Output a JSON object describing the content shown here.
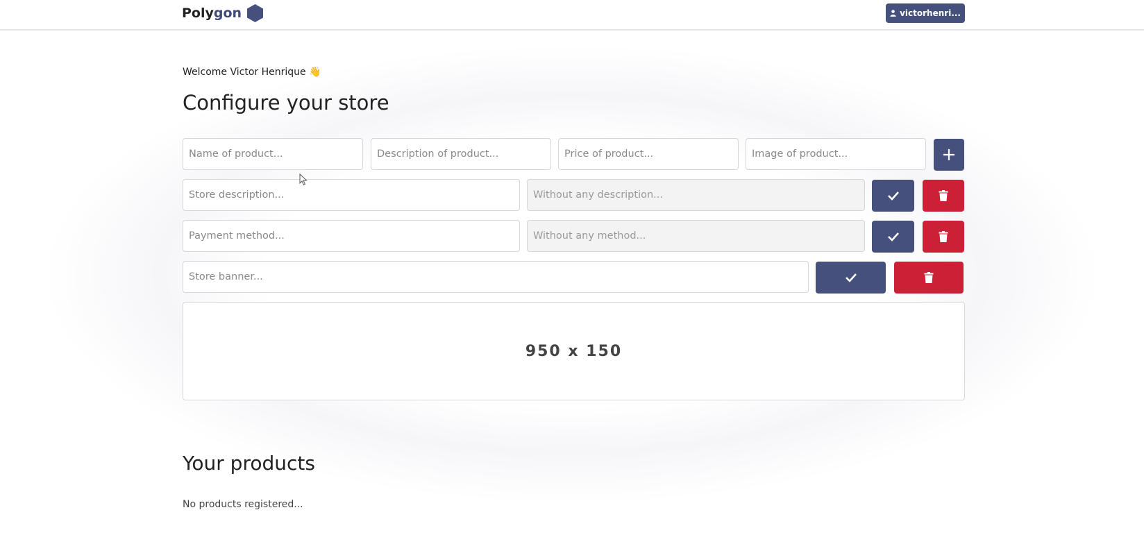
{
  "header": {
    "logo_prefix": "Poly",
    "logo_suffix": "gon",
    "user_label": "victorhenri..."
  },
  "welcome": "Welcome Victor Henrique 👋",
  "title": "Configure your store",
  "product_form": {
    "name_placeholder": "Name of product...",
    "description_placeholder": "Description of product...",
    "price_placeholder": "Price of product...",
    "image_placeholder": "Image of product..."
  },
  "store_description": {
    "placeholder": "Store description...",
    "current_placeholder": "Without any description..."
  },
  "payment_method": {
    "placeholder": "Payment method...",
    "current_placeholder": "Without any method..."
  },
  "store_banner": {
    "placeholder": "Store banner...",
    "preview_text": "950 x 150"
  },
  "products": {
    "title": "Your products",
    "empty_text": "No products registered..."
  },
  "colors": {
    "primary": "#45507d",
    "danger": "#cc2036"
  },
  "icons": [
    "hexagon-icon",
    "user-icon",
    "plus-icon",
    "check-icon",
    "trash-icon",
    "cursor-icon"
  ]
}
